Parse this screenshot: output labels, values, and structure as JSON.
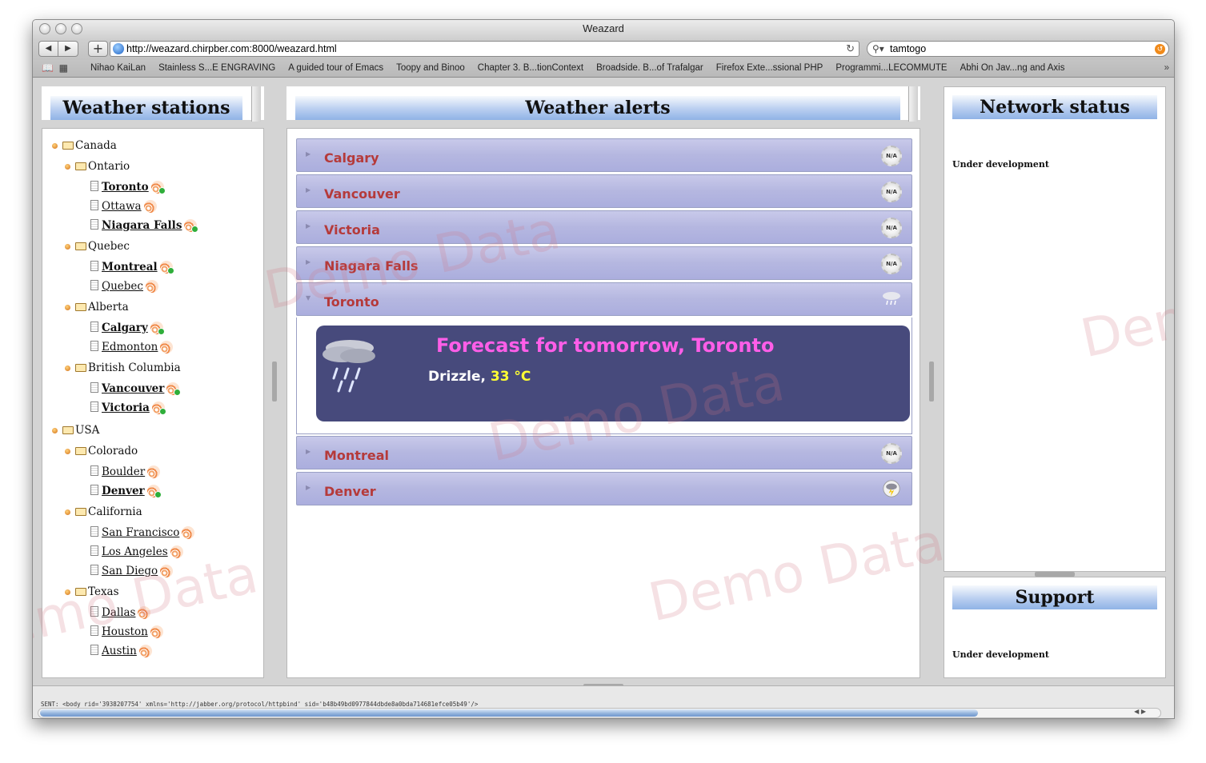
{
  "window": {
    "title": "Weazard"
  },
  "toolbar": {
    "back": "◀",
    "forward": "▶",
    "add": "+",
    "url": "http://weazard.chirpber.com:8000/weazard.html",
    "search_value": "tamtogo"
  },
  "bookmarks": [
    "Nihao KaiLan",
    "Stainless S...E ENGRAVING",
    "A guided tour of Emacs",
    "Toopy and Binoo",
    "Chapter 3. B...tionContext",
    "Broadside. B...of Trafalgar",
    "Firefox Exte...ssional PHP",
    "Programmi...LECOMMUTE",
    "Abhi On Jav...ng and Axis"
  ],
  "stations": {
    "title": "Weather stations",
    "tree": [
      {
        "label": "Canada",
        "level": 0,
        "kind": "country"
      },
      {
        "label": "Ontario",
        "level": 1,
        "kind": "region"
      },
      {
        "label": "Toronto",
        "level": 2,
        "kind": "city",
        "bold": true,
        "green": true
      },
      {
        "label": "Ottawa",
        "level": 2,
        "kind": "city",
        "bold": false,
        "green": false
      },
      {
        "label": "Niagara Falls",
        "level": 2,
        "kind": "city",
        "bold": true,
        "green": true
      },
      {
        "label": "Quebec",
        "level": 1,
        "kind": "region"
      },
      {
        "label": "Montreal",
        "level": 2,
        "kind": "city",
        "bold": true,
        "green": true
      },
      {
        "label": "Quebec",
        "level": 2,
        "kind": "city",
        "bold": false,
        "green": false
      },
      {
        "label": "Alberta",
        "level": 1,
        "kind": "region"
      },
      {
        "label": "Calgary",
        "level": 2,
        "kind": "city",
        "bold": true,
        "green": true
      },
      {
        "label": "Edmonton",
        "level": 2,
        "kind": "city",
        "bold": false,
        "green": false
      },
      {
        "label": "British Columbia",
        "level": 1,
        "kind": "region"
      },
      {
        "label": "Vancouver",
        "level": 2,
        "kind": "city",
        "bold": true,
        "green": true
      },
      {
        "label": "Victoria",
        "level": 2,
        "kind": "city",
        "bold": true,
        "green": true
      },
      {
        "label": "USA",
        "level": 0,
        "kind": "country"
      },
      {
        "label": "Colorado",
        "level": 1,
        "kind": "region"
      },
      {
        "label": "Boulder",
        "level": 2,
        "kind": "city",
        "bold": false,
        "green": false
      },
      {
        "label": "Denver",
        "level": 2,
        "kind": "city",
        "bold": true,
        "green": true
      },
      {
        "label": "California",
        "level": 1,
        "kind": "region"
      },
      {
        "label": "San Francisco",
        "level": 2,
        "kind": "city",
        "bold": false,
        "green": false
      },
      {
        "label": "Los Angeles",
        "level": 2,
        "kind": "city",
        "bold": false,
        "green": false
      },
      {
        "label": "San Diego",
        "level": 2,
        "kind": "city",
        "bold": false,
        "green": false
      },
      {
        "label": "Texas",
        "level": 1,
        "kind": "region"
      },
      {
        "label": "Dallas",
        "level": 2,
        "kind": "city",
        "bold": false,
        "green": false
      },
      {
        "label": "Houston",
        "level": 2,
        "kind": "city",
        "bold": false,
        "green": false
      },
      {
        "label": "Austin",
        "level": 2,
        "kind": "city",
        "bold": false,
        "green": false
      }
    ]
  },
  "alerts": {
    "title": "Weather alerts",
    "items": [
      {
        "city": "Calgary",
        "icon": "na-icon",
        "icon_text": "N/A"
      },
      {
        "city": "Vancouver",
        "icon": "na-icon",
        "icon_text": "N/A"
      },
      {
        "city": "Victoria",
        "icon": "na-icon",
        "icon_text": "N/A"
      },
      {
        "city": "Niagara Falls",
        "icon": "na-icon",
        "icon_text": "N/A"
      },
      {
        "city": "Toronto",
        "icon": "drizzle-icon",
        "expanded": true
      },
      {
        "city": "Montreal",
        "icon": "na-icon",
        "icon_text": "N/A"
      },
      {
        "city": "Denver",
        "icon": "thunderstorm-icon"
      }
    ],
    "forecast": {
      "title": "Forecast for tomorrow, Toronto",
      "condition": "Drizzle,",
      "temperature": "33 °C"
    }
  },
  "network": {
    "title": "Network status",
    "text": "Under development"
  },
  "support": {
    "title": "Support",
    "text": "Under development"
  },
  "status": {
    "sent": "SENT: <body rid='3938207754' xmlns='http://jabber.org/protocol/httpbind' sid='b48b49bd0977844dbde8a0bda714681efce05b49'/>"
  },
  "watermark": "Demo Data",
  "colors": {
    "header_gradient": "#8fb3e6",
    "alert_bar": "#b5b7e0",
    "city_text": "#b53a3a",
    "forecast_bg": "#474a7c",
    "forecast_title": "#ff5ee8",
    "forecast_temp": "#ffff33"
  }
}
